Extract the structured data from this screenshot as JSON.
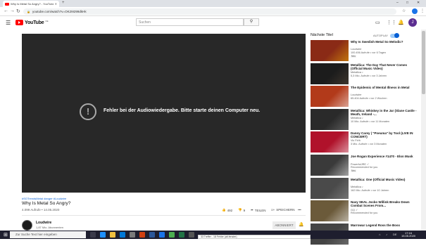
{
  "browser": {
    "tab_title": "Why Is Metal So Angry? - YouTube",
    "new_tab": "+",
    "url": "youtube.com/watch?v=OK29I299dkHk"
  },
  "youtube": {
    "logo": "YouTube",
    "logo_cc": "DE",
    "search_placeholder": "Suchen"
  },
  "player": {
    "error_icon": "!",
    "error_text": "Fehler bei der Audiowiedergabe. Bitte starte deinen Computer neu."
  },
  "video": {
    "tags": "#SOTrendsMetal #anger #Loudwire",
    "title": "Why Is Metal So Angry?",
    "views_date": "4.099 Aufrufe • 14.05.2020",
    "likes": "492",
    "dislikes": "9",
    "share": "TEILEN",
    "save": "SPEICHERN",
    "more": "•••"
  },
  "channel": {
    "name": "Loudwire",
    "subscribers": "1,87 Mio. Abonnenten",
    "subscribed_label": "ABONNIERT"
  },
  "sidebar": {
    "heading": "Nächste Titel",
    "autoplay_label": "AUTOPLAY",
    "autoplay_on": true,
    "items": [
      {
        "title": "Why Is Swedish Metal So Melodic?",
        "channel": "Loudwire",
        "meta": "100.456 Aufrufe • vor 6 Tagen",
        "badge": "Neu",
        "thumb_color": "#8a2a16",
        "accent": "#f2b705"
      },
      {
        "title": "Metallica: The Day That Never Comes (Official Music Video)",
        "channel": "Metallica ♪",
        "meta": "5,3 Mio. Aufrufe • vor 3 Jahren",
        "badge": "",
        "thumb_color": "#1c1c1c",
        "accent": "#5a4a3a"
      },
      {
        "title": "The Epidemic of Mental Illness in Metal",
        "channel": "Loudwire",
        "meta": "65.404 Aufrufe • vor 2 Wochen",
        "badge": "",
        "thumb_color": "#b23a1a",
        "accent": "#ffffff"
      },
      {
        "title": "Metallica: Whiskey in the Jar (Slane Castle - Meath, Ireland -...",
        "channel": "Metallica ♪",
        "meta": "10 Mio. Aufrufe • vor 11 Monaten",
        "badge": "",
        "thumb_color": "#2a2a2a",
        "accent": "#888888"
      },
      {
        "title": "Danny Carey | \"Pneuma\" by Tool (LIVE IN CONCERT)",
        "channel": "Vic Firth",
        "meta": "3 Mio. Aufrufe • vor 3 Monaten",
        "badge": "",
        "thumb_color": "#b0122b",
        "accent": "#ffffff"
      },
      {
        "title": "Joe Rogan Experience #1470 - Elon Musk",
        "channel": "PowerfulJRE ✓",
        "meta": "Recommended for you",
        "badge": "Neu",
        "thumb_color": "#3a3a3a",
        "accent": "#ffffff"
      },
      {
        "title": "Metallica: One (Official Music Video)",
        "channel": "Metallica ♪",
        "meta": "162 Mio. Aufrufe • vor 10 Jahren",
        "badge": "",
        "thumb_color": "#4a4a4a",
        "accent": "#999999"
      },
      {
        "title": "Navy SEAL Jocko Willink Breaks Down Combat Scenes From...",
        "channel": "GQ ✓",
        "meta": "Recommended for you",
        "badge": "",
        "thumb_color": "#6b5a3a",
        "accent": "#ffffff"
      },
      {
        "title": "Marrowar Legend Ross the Boss",
        "channel": "",
        "meta": "",
        "badge": "",
        "thumb_color": "#444444",
        "accent": "#888888"
      }
    ]
  },
  "taskbar": {
    "search_placeholder": "Zur Suche Text hier eingeben",
    "notification": "33 Treffer - 18 Fehler (alt.fenster)",
    "time": "17:16",
    "date": "15.05.2020"
  },
  "colors": {
    "accent_red": "#ff0000",
    "link_blue": "#065fd4",
    "player_bg": "#282828",
    "taskbar_bg": "#1e1e2e"
  }
}
